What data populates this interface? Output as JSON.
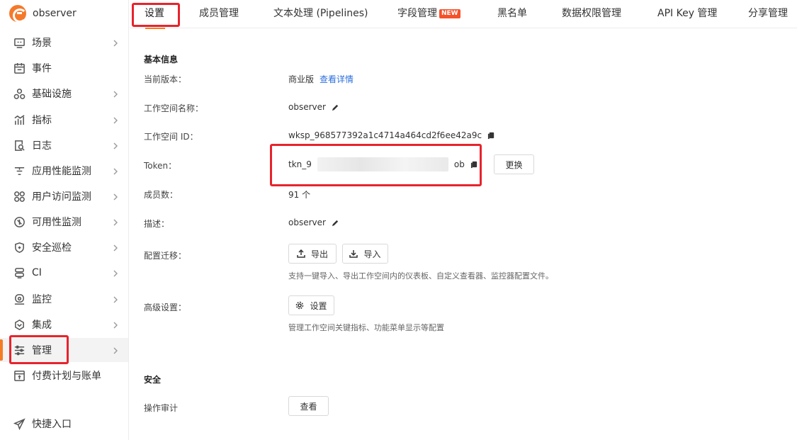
{
  "brand": {
    "name": "observer"
  },
  "sidebar": {
    "items": [
      {
        "label": "场景",
        "icon": "monitor-icon",
        "has_children": true
      },
      {
        "label": "事件",
        "icon": "calendar-icon",
        "has_children": false
      },
      {
        "label": "基础设施",
        "icon": "cluster-icon",
        "has_children": true
      },
      {
        "label": "指标",
        "icon": "bar-chart-icon",
        "has_children": true
      },
      {
        "label": "日志",
        "icon": "log-search-icon",
        "has_children": true
      },
      {
        "label": "应用性能监测",
        "icon": "apm-icon",
        "has_children": true
      },
      {
        "label": "用户访问监测",
        "icon": "rum-icon",
        "has_children": true
      },
      {
        "label": "可用性监测",
        "icon": "probe-icon",
        "has_children": true
      },
      {
        "label": "安全巡检",
        "icon": "shield-icon",
        "has_children": true
      },
      {
        "label": "CI",
        "icon": "ci-icon",
        "has_children": true
      },
      {
        "label": "监控",
        "icon": "alarm-icon",
        "has_children": true
      },
      {
        "label": "集成",
        "icon": "integration-icon",
        "has_children": true
      },
      {
        "label": "管理",
        "icon": "sliders-icon",
        "has_children": true,
        "active": true
      },
      {
        "label": "付费计划与账单",
        "icon": "billing-icon",
        "has_children": false
      }
    ],
    "quick_entry": {
      "label": "快捷入口",
      "icon": "send-icon"
    }
  },
  "tabs": [
    {
      "label": "设置",
      "active": true
    },
    {
      "label": "成员管理"
    },
    {
      "label": "文本处理 (Pipelines)"
    },
    {
      "label": "字段管理",
      "badge": "NEW"
    },
    {
      "label": "黑名单"
    },
    {
      "label": "数据权限管理"
    },
    {
      "label": "API Key 管理"
    },
    {
      "label": "分享管理"
    }
  ],
  "basic": {
    "title": "基本信息",
    "version_label": "当前版本：",
    "version_value": "商业版",
    "version_link": "查看详情",
    "workspace_name_label": "工作空间名称：",
    "workspace_name_value": "observer",
    "workspace_id_label": "工作空间 ID：",
    "workspace_id_value": "wksp_968577392a1c4714a464cd2f6ee42a9c",
    "token_label": "Token：",
    "token_prefix": "tkn_9",
    "token_suffix": "ob",
    "token_change_button": "更换",
    "members_label": "成员数：",
    "members_value": "91 个",
    "desc_label": "描述：",
    "desc_value": "observer",
    "migrate_label": "配置迁移：",
    "export_button": "导出",
    "import_button": "导入",
    "migrate_hint": "支持一键导入、导出工作空间内的仪表板、自定义查看器、监控器配置文件。",
    "advanced_label": "高级设置：",
    "advanced_button": "设置",
    "advanced_hint": "管理工作空间关键指标、功能菜单显示等配置"
  },
  "security": {
    "title": "安全",
    "audit_label": "操作审计",
    "audit_button": "查看"
  },
  "colors": {
    "accent": "#f57c22",
    "highlight": "#e8232c",
    "link": "#2b6fde"
  }
}
